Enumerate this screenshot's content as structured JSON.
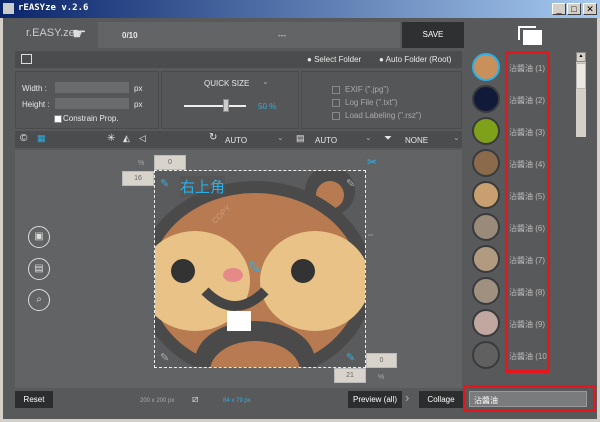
{
  "window": {
    "title": "rEASYze v.2.6",
    "min": "_",
    "max": "□",
    "close": "✕"
  },
  "header": {
    "logo": "r.EASY.ze",
    "progress": "0/10",
    "status": "---",
    "save": "SAVE"
  },
  "folder_bar": {
    "select_folder": "Select Folder",
    "auto_folder": "Auto Folder (Root)"
  },
  "size_panel": {
    "width_label": "Width :",
    "height_label": "Height :",
    "unit": "px",
    "constrain": "Constrain Prop.",
    "width_value": "",
    "height_value": ""
  },
  "quick_size": {
    "label": "QUICK SIZE",
    "percent": "50 %",
    "value": 50
  },
  "options": {
    "exif": "EXIF (\".jpg\")",
    "log": "Log File (\".txt\")",
    "labeling": "Load Labeling (\".rsz\")"
  },
  "toolbar": {
    "rotate": "AUTO",
    "format": "AUTO",
    "filter": "NONE"
  },
  "canvas": {
    "top_value": "0",
    "left_value": "16",
    "right_value": "0",
    "bottom_value": "21",
    "pct": "%",
    "watermark": "右上角",
    "copy": "COPY"
  },
  "bottom": {
    "reset": "Reset",
    "original_size": "200 x 200 px",
    "crop_size": "84 x 79 px",
    "preview": "Preview (all)",
    "collage": "Collage"
  },
  "files": [
    {
      "label": "沾醬油 (1)",
      "active": true
    },
    {
      "label": "沾醬油 (2)"
    },
    {
      "label": "沾醬油 (3)"
    },
    {
      "label": "沾醬油 (4)"
    },
    {
      "label": "沾醬油 (5)"
    },
    {
      "label": "沾醬油 (6)"
    },
    {
      "label": "沾醬油 (7)"
    },
    {
      "label": "沾醬油 (8)"
    },
    {
      "label": "沾醬油 (9)"
    },
    {
      "label": "沾醬油 (10)"
    }
  ],
  "rename_input": "沾醬油",
  "colors": {
    "accent": "#2ab0e8",
    "highlight": "#e8161c"
  }
}
